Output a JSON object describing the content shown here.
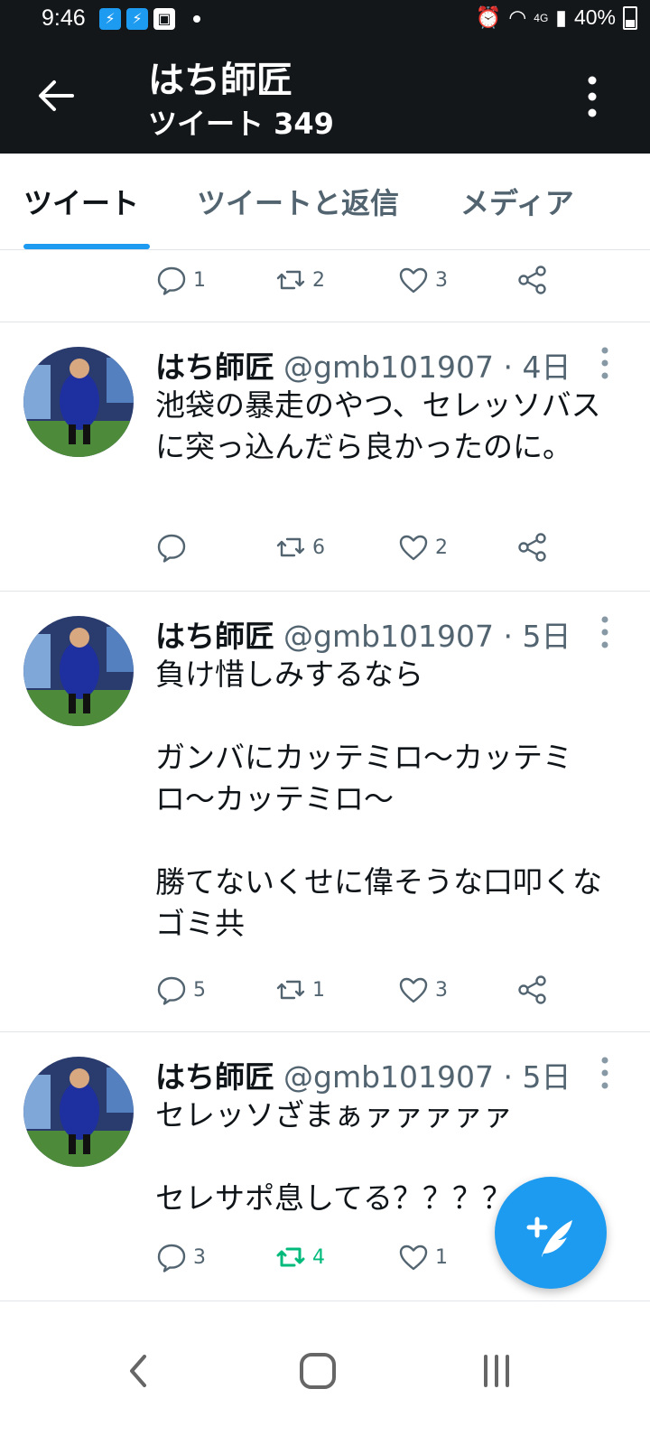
{
  "status_bar": {
    "time": "9:46",
    "network": "4G",
    "battery": "40%",
    "icons": [
      "bolt-icon",
      "bolt-icon",
      "image-icon",
      "alarm-icon",
      "wifi-icon",
      "signal-icon",
      "battery-icon"
    ]
  },
  "header": {
    "name": "はち師匠",
    "tweet_count": "ツイート 349"
  },
  "tabs": [
    {
      "label": "ツイート",
      "active": true
    },
    {
      "label": "ツイートと返信",
      "active": false
    },
    {
      "label": "メディア",
      "active": false
    }
  ],
  "partial_tweet": {
    "replies": "1",
    "retweets": "2",
    "likes": "3"
  },
  "tweets": [
    {
      "name": "はち師匠",
      "handle": "@gmb101907 · 4日",
      "text": "池袋の暴走のやつ、セレッソバスに突っ込んだら良かったのに。",
      "replies": "",
      "retweets": "6",
      "likes": "2",
      "retweeted": false
    },
    {
      "name": "はち師匠",
      "handle": "@gmb101907 · 5日",
      "text": "負け惜しみするなら\n\nガンバにカッテミロ〜カッテミロ〜カッテミロ〜\n\n勝てないくせに偉そうな口叩くなゴミ共",
      "replies": "5",
      "retweets": "1",
      "likes": "3",
      "retweeted": false
    },
    {
      "name": "はち師匠",
      "handle": "@gmb101907 · 5日",
      "text": "セレッソざまぁァァァァァ\n\nセレサポ息してる？？？？",
      "replies": "3",
      "retweets": "4",
      "likes": "1",
      "retweeted": true
    }
  ],
  "colors": {
    "header_bg": "#14171a",
    "accent": "#1d9bf0",
    "retweet_active": "#00ba7c",
    "secondary_text": "#536471"
  }
}
